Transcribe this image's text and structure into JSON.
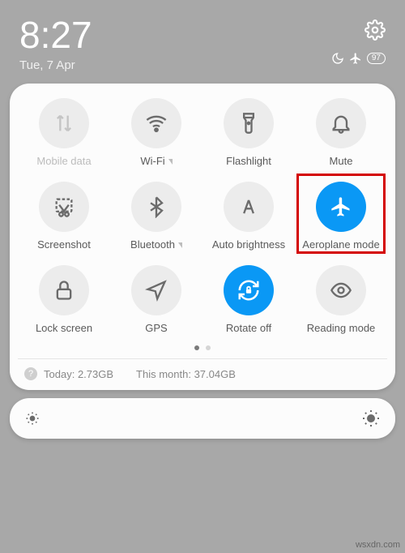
{
  "header": {
    "time": "8:27",
    "date": "Tue, 7 Apr",
    "battery": "97"
  },
  "tiles": [
    {
      "label": "Mobile data",
      "state": "disabled",
      "chevron": false
    },
    {
      "label": "Wi-Fi",
      "state": "off",
      "chevron": true
    },
    {
      "label": "Flashlight",
      "state": "off",
      "chevron": false
    },
    {
      "label": "Mute",
      "state": "off",
      "chevron": false
    },
    {
      "label": "Screenshot",
      "state": "off",
      "chevron": false
    },
    {
      "label": "Bluetooth",
      "state": "off",
      "chevron": true
    },
    {
      "label": "Auto brightness",
      "state": "off",
      "chevron": false
    },
    {
      "label": "Aeroplane mode",
      "state": "active",
      "chevron": false,
      "highlighted": true
    },
    {
      "label": "Lock screen",
      "state": "off",
      "chevron": false
    },
    {
      "label": "GPS",
      "state": "off",
      "chevron": false
    },
    {
      "label": "Rotate off",
      "state": "active",
      "chevron": false
    },
    {
      "label": "Reading mode",
      "state": "off",
      "chevron": false
    }
  ],
  "data_usage": {
    "today_label": "Today:",
    "today_value": "2.73GB",
    "month_label": "This month:",
    "month_value": "37.04GB"
  },
  "source": "wsxdn.com"
}
